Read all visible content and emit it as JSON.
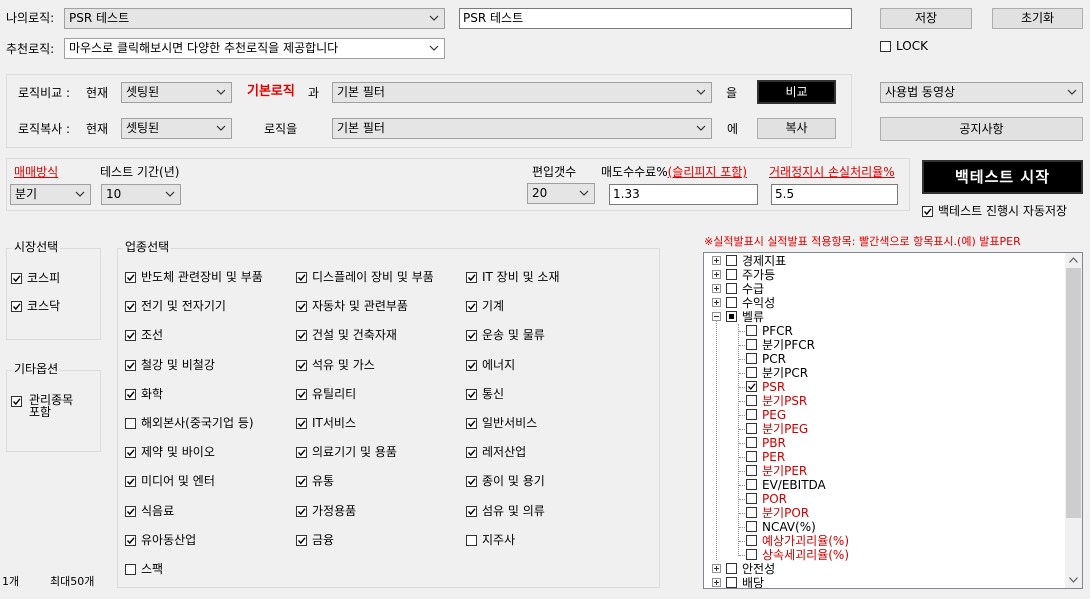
{
  "top": {
    "my_logic_label": "나의로직:",
    "my_logic_value": "PSR 테스트",
    "name_input_value": "PSR 테스트",
    "save_label": "저장",
    "reset_label": "초기화",
    "recommend_label": "추천로직:",
    "recommend_value": "마우스로 클릭해보시면 다양한 추천로직을 제공합니다",
    "lock_label": "LOCK"
  },
  "compare": {
    "compare_label": "로직비교 :",
    "current_label": "현재",
    "current_value": "셋팅된",
    "base_logic": "기본로직",
    "and_label": "과",
    "filter_value": "기본 필터",
    "eul_label": "을",
    "compare_button": "비교",
    "copy_label": "로직복사 :",
    "current_label2": "현재",
    "current_value2": "셋팅된",
    "logic_eul": "로직을",
    "filter_value2": "기본 필터",
    "e_label": "에",
    "copy_button": "복사"
  },
  "right": {
    "video_value": "사용법 동영상",
    "notice_button": "공지사항",
    "start_button": "백테스트 시작",
    "autosave_label": "백테스트 진행시 자동저장"
  },
  "params": {
    "trade_method_label": "매매방식",
    "trade_method_value": "분기",
    "test_period_label": "테스트 기간(년)",
    "test_period_value": "10",
    "holdings_label": "편입갯수",
    "holdings_value": "20",
    "fee_label": "매도수수료%",
    "fee_link": "(슬리피지 포함)",
    "fee_value": "1.33",
    "halt_label": "거래정지시 손실처리율%",
    "halt_value": "5.5"
  },
  "market": {
    "title": "시장선택",
    "items": [
      {
        "label": "코스피",
        "checked": true
      },
      {
        "label": "코스닥",
        "checked": true
      }
    ]
  },
  "other": {
    "title": "기타옵션",
    "item_line1": "관리종목",
    "item_line2": "포함"
  },
  "industry": {
    "title": "업종선택",
    "items": [
      {
        "label": "반도체 관련장비 및 부품",
        "checked": true
      },
      {
        "label": "디스플레이 장비 및 부품",
        "checked": true
      },
      {
        "label": "IT 장비 및 소재",
        "checked": true
      },
      {
        "label": "전기 및 전자기기",
        "checked": true
      },
      {
        "label": "자동차 및 관련부품",
        "checked": true
      },
      {
        "label": "기계",
        "checked": true
      },
      {
        "label": "조선",
        "checked": true
      },
      {
        "label": "건설 및 건축자재",
        "checked": true
      },
      {
        "label": "운송 및 물류",
        "checked": true
      },
      {
        "label": "철강 및 비철강",
        "checked": true
      },
      {
        "label": "석유 및 가스",
        "checked": true
      },
      {
        "label": "에너지",
        "checked": true
      },
      {
        "label": "화학",
        "checked": true
      },
      {
        "label": "유틸리티",
        "checked": true
      },
      {
        "label": "통신",
        "checked": true
      },
      {
        "label": "해외본사(중국기업 등)",
        "checked": false
      },
      {
        "label": "IT서비스",
        "checked": true
      },
      {
        "label": "일반서비스",
        "checked": true
      },
      {
        "label": "제약 및 바이오",
        "checked": true
      },
      {
        "label": "의료기기 및 용품",
        "checked": true
      },
      {
        "label": "레저산업",
        "checked": true
      },
      {
        "label": "미디어 및 엔터",
        "checked": true
      },
      {
        "label": "유통",
        "checked": true
      },
      {
        "label": "종이 및 용기",
        "checked": true
      },
      {
        "label": "식음료",
        "checked": true
      },
      {
        "label": "가정용품",
        "checked": true
      },
      {
        "label": "섬유 및 의류",
        "checked": true
      },
      {
        "label": "유아동산업",
        "checked": true
      },
      {
        "label": "금융",
        "checked": true
      },
      {
        "label": "지주사",
        "checked": false
      },
      {
        "label": "스팩",
        "checked": false
      }
    ]
  },
  "footer": {
    "count": "1개",
    "max": "최대50개"
  },
  "tree": {
    "notice": "※실적발표시 실적발표 적용항목: 빨간색으로 항목표시.(예) 발표PER",
    "items": [
      {
        "label": "경제지표",
        "level": 0,
        "expander": "plus",
        "state": "none",
        "red": false
      },
      {
        "label": "주가등",
        "level": 0,
        "expander": "plus",
        "state": "none",
        "red": false
      },
      {
        "label": "수급",
        "level": 0,
        "expander": "plus",
        "state": "none",
        "red": false
      },
      {
        "label": "수익성",
        "level": 0,
        "expander": "plus",
        "state": "none",
        "red": false
      },
      {
        "label": "벨류",
        "level": 0,
        "expander": "minus",
        "state": "partial",
        "red": false
      },
      {
        "label": "PFCR",
        "level": 1,
        "state": "none",
        "red": false
      },
      {
        "label": "분기PFCR",
        "level": 1,
        "state": "none",
        "red": false
      },
      {
        "label": "PCR",
        "level": 1,
        "state": "none",
        "red": false
      },
      {
        "label": "분기PCR",
        "level": 1,
        "state": "none",
        "red": false
      },
      {
        "label": "PSR",
        "level": 1,
        "state": "checked",
        "red": true
      },
      {
        "label": "분기PSR",
        "level": 1,
        "state": "none",
        "red": true
      },
      {
        "label": "PEG",
        "level": 1,
        "state": "none",
        "red": true
      },
      {
        "label": "분기PEG",
        "level": 1,
        "state": "none",
        "red": true
      },
      {
        "label": "PBR",
        "level": 1,
        "state": "none",
        "red": true
      },
      {
        "label": "PER",
        "level": 1,
        "state": "none",
        "red": true
      },
      {
        "label": "분기PER",
        "level": 1,
        "state": "none",
        "red": true
      },
      {
        "label": "EV/EBITDA",
        "level": 1,
        "state": "none",
        "red": false
      },
      {
        "label": "POR",
        "level": 1,
        "state": "none",
        "red": true
      },
      {
        "label": "분기POR",
        "level": 1,
        "state": "none",
        "red": true
      },
      {
        "label": "NCAV(%)",
        "level": 1,
        "state": "none",
        "red": false
      },
      {
        "label": "예상가괴리율(%)",
        "level": 1,
        "state": "none",
        "red": true
      },
      {
        "label": "상속세괴리율(%)",
        "level": 1,
        "state": "none",
        "red": true
      },
      {
        "label": "안전성",
        "level": 0,
        "expander": "plus",
        "state": "none",
        "red": false
      },
      {
        "label": "배당",
        "level": 0,
        "expander": "plus",
        "state": "none",
        "red": false
      }
    ]
  }
}
